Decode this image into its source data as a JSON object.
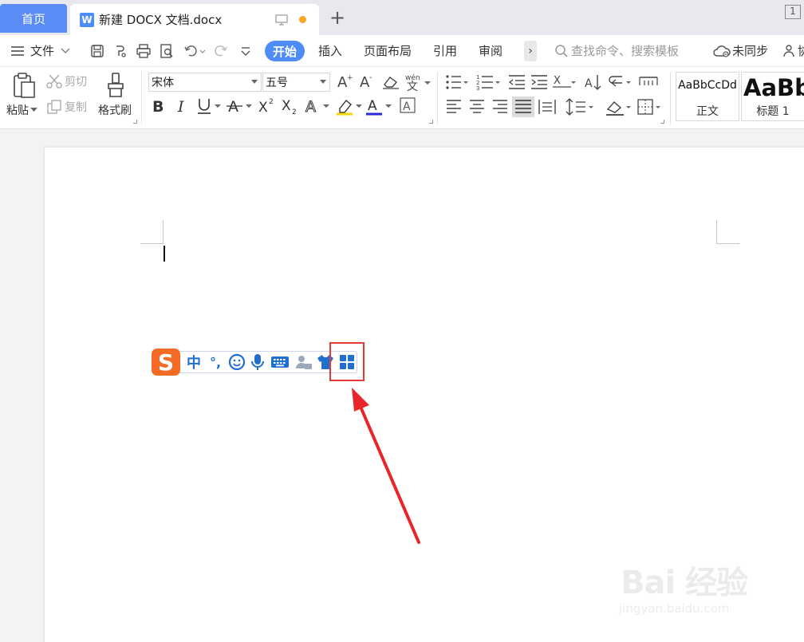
{
  "tabs": {
    "home": "首页",
    "doc": "新建 DOCX 文档.docx",
    "window_count": "1"
  },
  "menu": {
    "file": "文件",
    "start": "开始",
    "insert": "插入",
    "layout": "页面布局",
    "reference": "引用",
    "review": "审阅",
    "more": "›",
    "search_placeholder": "查找命令、搜索模板",
    "sync": "未同步",
    "collab": "协"
  },
  "ribbon": {
    "paste": "粘贴",
    "cut": "剪切",
    "copy": "复制",
    "format_painter": "格式刷",
    "font_family": "宋体",
    "font_size": "五号",
    "phonetic": "wén",
    "style_normal_sample": "AaBbCcDd",
    "style_normal_name": "正文",
    "style_h1_sample": "AaBb",
    "style_h1_name": "标题 1"
  },
  "ime": {
    "chinese_mode": "中",
    "punctuation": "°,"
  },
  "watermark": {
    "brand": "Bai  经验",
    "url": "jingyan.baidu.com"
  },
  "colors": {
    "accent": "#4e8cf7",
    "home_tab": "#5b8cf5",
    "ime_orange": "#f36b24",
    "ime_blue": "#1f6fd1",
    "highlight_red": "#e53935"
  }
}
